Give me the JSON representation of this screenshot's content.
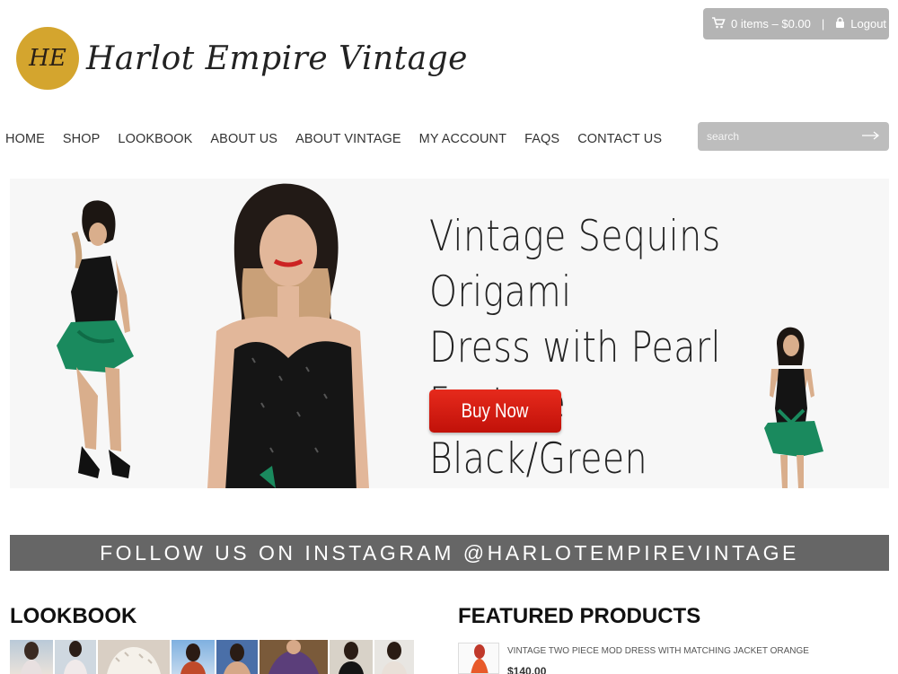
{
  "brand": {
    "monogram": "HE",
    "name": "Harlot Empire Vintage",
    "badge_color": "#d4a52e"
  },
  "topbar": {
    "cart_icon": "cart-icon",
    "cart_label": "0 items – $0.00",
    "separator": "|",
    "lock_icon": "lock-icon",
    "logout_label": "Logout"
  },
  "nav": {
    "items": [
      "HOME",
      "SHOP",
      "LOOKBOOK",
      "ABOUT US",
      "ABOUT VINTAGE",
      "MY ACCOUNT",
      "FAQS",
      "CONTACT US"
    ]
  },
  "search": {
    "placeholder": "search",
    "submit_icon": "arrow-right-icon"
  },
  "hero": {
    "title_lines": [
      "Vintage Sequins Origami",
      "Dress with Pearl Feature",
      "Black/Green"
    ],
    "button_label": "Buy Now",
    "button_color": "#d81e13"
  },
  "instagram": {
    "label": "FOLLOW US ON INSTAGRAM @HARLOTEMPIREVINTAGE"
  },
  "lookbook": {
    "title": "LOOKBOOK"
  },
  "featured": {
    "title": "FEATURED PRODUCTS",
    "items": [
      {
        "name": "VINTAGE TWO PIECE MOD DRESS WITH MATCHING JACKET ORANGE",
        "price": "$140.00"
      }
    ]
  }
}
